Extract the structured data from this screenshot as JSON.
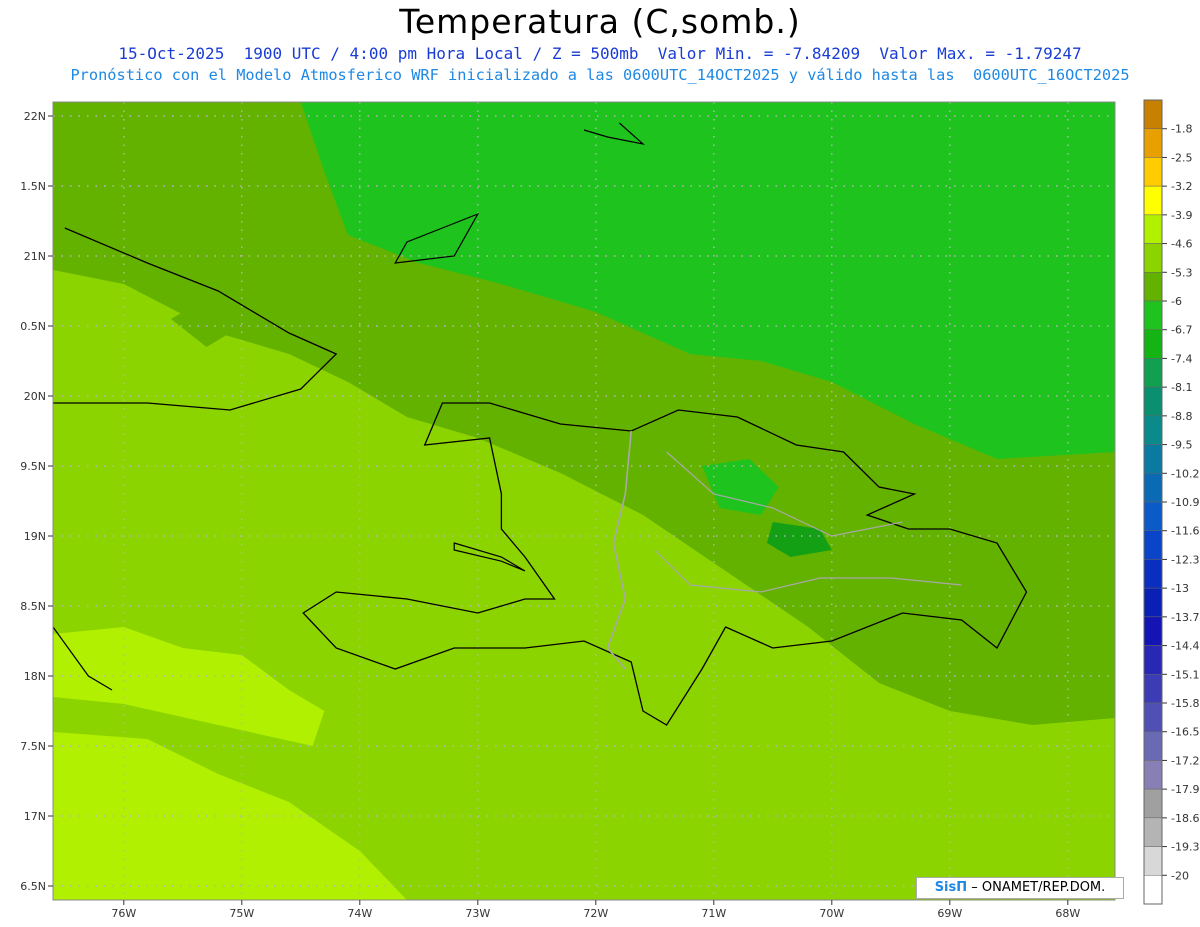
{
  "header": {
    "title": "Temperatura (C,somb.)",
    "line1": "15-Oct-2025  1900 UTC / 4:00 pm Hora Local / Z = 500mb  Valor Min. = -7.84209  Valor Max. = -1.79247",
    "line2": "Pronóstico con el Modelo Atmosferico WRF inicializado a las 0600UTC_14OCT2025 y válido hasta las  0600UTC_16OCT2025"
  },
  "map": {
    "lon_range": [
      -76.6,
      -67.6
    ],
    "lat_range": [
      16.4,
      22.1
    ],
    "lat_ticks": [
      {
        "value": 22,
        "label": "22N"
      },
      {
        "value": 21.5,
        "label": "1.5N"
      },
      {
        "value": 21,
        "label": "21N"
      },
      {
        "value": 20.5,
        "label": "0.5N"
      },
      {
        "value": 20,
        "label": "20N"
      },
      {
        "value": 19.5,
        "label": "9.5N"
      },
      {
        "value": 19,
        "label": "19N"
      },
      {
        "value": 18.5,
        "label": "8.5N"
      },
      {
        "value": 18,
        "label": "18N"
      },
      {
        "value": 17.5,
        "label": "7.5N"
      },
      {
        "value": 17,
        "label": "17N"
      },
      {
        "value": 16.5,
        "label": "6.5N"
      }
    ],
    "lon_ticks": [
      {
        "value": -76,
        "label": "76W"
      },
      {
        "value": -75,
        "label": "75W"
      },
      {
        "value": -74,
        "label": "74W"
      },
      {
        "value": -73,
        "label": "73W"
      },
      {
        "value": -72,
        "label": "72W"
      },
      {
        "value": -71,
        "label": "71W"
      },
      {
        "value": -70,
        "label": "70W"
      },
      {
        "value": -69,
        "label": "69W"
      },
      {
        "value": -68,
        "label": "68W"
      }
    ],
    "colors": {
      "light": "#b0f000",
      "mid": "#8cd400",
      "dark": "#64b200",
      "green": "#1ec31e",
      "deep": "#14a014",
      "coast": "#000000",
      "border": "#a8a8a8"
    }
  },
  "legend": [
    {
      "label": "-1.8",
      "color": "#c88000"
    },
    {
      "label": "-2.5",
      "color": "#e8a000"
    },
    {
      "label": "-3.2",
      "color": "#ffcc00"
    },
    {
      "label": "-3.9",
      "color": "#ffff00"
    },
    {
      "label": "-4.6",
      "color": "#b0f000"
    },
    {
      "label": "-5.3",
      "color": "#8cd400"
    },
    {
      "label": "-6",
      "color": "#64b200"
    },
    {
      "label": "-6.7",
      "color": "#1ec31e"
    },
    {
      "label": "-7.4",
      "color": "#14b414"
    },
    {
      "label": "-8.1",
      "color": "#10a050"
    },
    {
      "label": "-8.8",
      "color": "#0a9070"
    },
    {
      "label": "-9.5",
      "color": "#0a8a8a"
    },
    {
      "label": "-10.2",
      "color": "#0a7aa0"
    },
    {
      "label": "-10.9",
      "color": "#0a6ab4"
    },
    {
      "label": "-11.6",
      "color": "#0a5ac8"
    },
    {
      "label": "-12.3",
      "color": "#0a44c8"
    },
    {
      "label": "-13",
      "color": "#0a2ec0"
    },
    {
      "label": "-13.7",
      "color": "#0a20b4"
    },
    {
      "label": "-14.4",
      "color": "#1414b4"
    },
    {
      "label": "-15.1",
      "color": "#2828b4"
    },
    {
      "label": "-15.8",
      "color": "#3c3cb4"
    },
    {
      "label": "-16.5",
      "color": "#5050b4"
    },
    {
      "label": "-17.2",
      "color": "#6a6ab4"
    },
    {
      "label": "-17.9",
      "color": "#8880b4"
    },
    {
      "label": "-18.6",
      "color": "#a0a0a0"
    },
    {
      "label": "-19.3",
      "color": "#b4b4b4"
    },
    {
      "label": "-20",
      "color": "#d8d8d8"
    },
    {
      "label": "",
      "color": "#ffffff"
    }
  ],
  "credit": {
    "brand": "SisΠ",
    "text": "– ONAMET/REP.DOM."
  }
}
